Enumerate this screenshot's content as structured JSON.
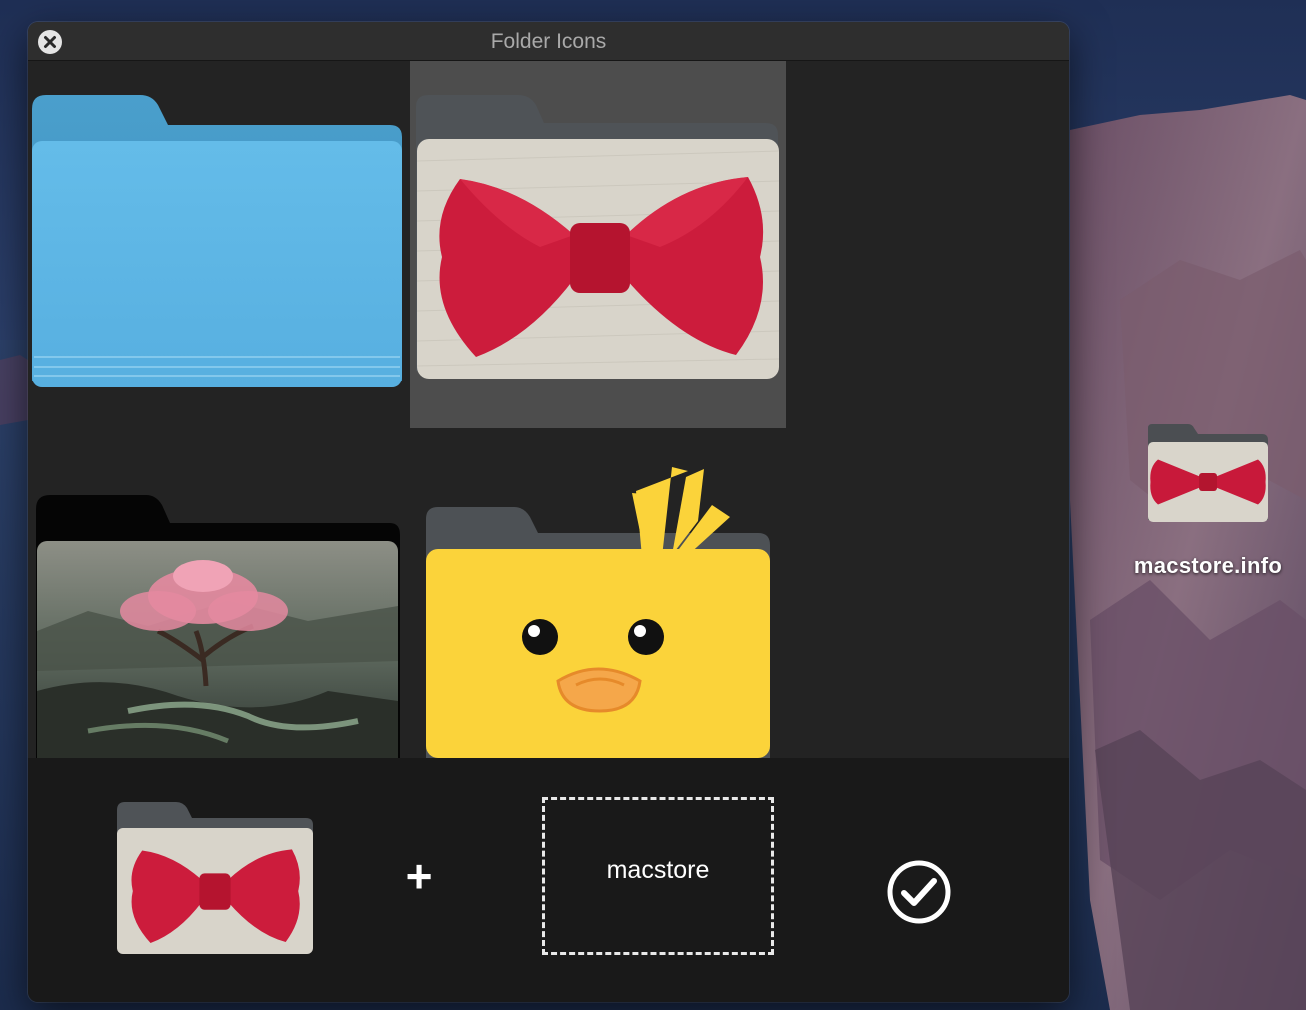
{
  "window": {
    "title": "Folder Icons",
    "close_icon": "close-icon"
  },
  "gallery": {
    "tiles": [
      {
        "name": "blue-folder",
        "selected": false
      },
      {
        "name": "bowtie-folder",
        "selected": true
      },
      {
        "name": "cherry-tree-folder",
        "selected": false
      },
      {
        "name": "duck-folder",
        "selected": false
      }
    ]
  },
  "composer": {
    "plus_label": "+",
    "text_input_value": "macstore",
    "apply_icon": "checkmark-circle-icon"
  },
  "desktop": {
    "icon_label": "macstore.info"
  },
  "colors": {
    "window_bg": "#232323",
    "selected_tile": "#4d4d4d",
    "folder_blue": "#5ab5e6",
    "duck_yellow": "#fbd33a",
    "bowtie_red": "#c8193a"
  }
}
